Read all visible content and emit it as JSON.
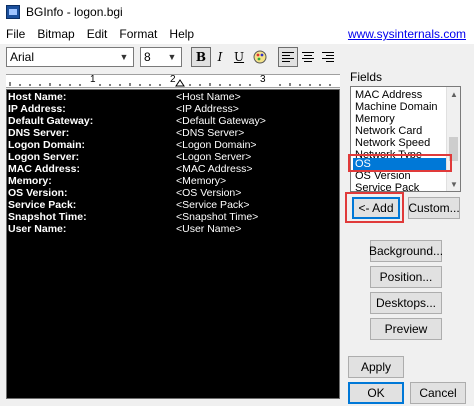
{
  "window": {
    "title": "BGInfo - logon.bgi"
  },
  "menu": {
    "items": [
      "File",
      "Bitmap",
      "Edit",
      "Format",
      "Help"
    ],
    "link": "www.sysinternals.com"
  },
  "toolbar": {
    "font_value": "Arial",
    "size_value": "8",
    "bold_glyph": "B",
    "italic_glyph": "I",
    "underline_glyph": "U"
  },
  "ruler": {
    "numbers": [
      "1",
      "2",
      "3"
    ]
  },
  "editor": {
    "rows": [
      {
        "label": "Host Name:",
        "value": "<Host Name>"
      },
      {
        "label": "IP Address:",
        "value": "<IP Address>"
      },
      {
        "label": "Default Gateway:",
        "value": "<Default Gateway>"
      },
      {
        "label": "DNS Server:",
        "value": "<DNS Server>"
      },
      {
        "label": "Logon Domain:",
        "value": "<Logon Domain>"
      },
      {
        "label": "Logon Server:",
        "value": "<Logon Server>"
      },
      {
        "label": "MAC Address:",
        "value": "<MAC Address>"
      },
      {
        "label": "Memory:",
        "value": "<Memory>"
      },
      {
        "label": "OS Version:",
        "value": "<OS Version>"
      },
      {
        "label": "Service Pack:",
        "value": "<Service Pack>"
      },
      {
        "label": "Snapshot Time:",
        "value": "<Snapshot Time>"
      },
      {
        "label": "User Name:",
        "value": "<User Name>"
      }
    ]
  },
  "fields": {
    "label": "Fields",
    "items": [
      "MAC Address",
      "Machine Domain",
      "Memory",
      "Network Card",
      "Network Speed",
      "Network Type",
      "OS",
      "OS Version",
      "Service Pack"
    ],
    "selected": "OS"
  },
  "buttons": {
    "add": "<- Add",
    "custom": "Custom...",
    "background": "Background...",
    "position": "Position...",
    "desktops": "Desktops...",
    "preview": "Preview",
    "apply": "Apply",
    "ok": "OK",
    "cancel": "Cancel"
  },
  "colors": {
    "editor_bg": "#000000",
    "selection": "#0078d7",
    "highlight": "#e03a3a",
    "link": "#0000ee"
  }
}
